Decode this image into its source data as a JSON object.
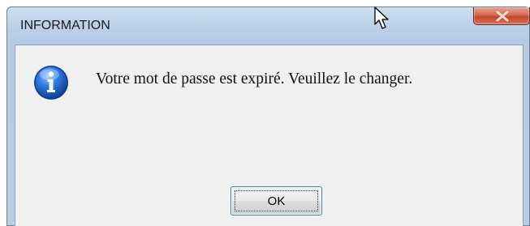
{
  "window": {
    "title": "INFORMATION",
    "close_glyph": "x",
    "close_button_color": "#c3462c",
    "frame_color": "#b9cde5"
  },
  "dialog": {
    "icon": "information-icon",
    "icon_color": "#1f5fbf",
    "message": "Votre mot de passe est expiré. Veuillez le changer.",
    "ok_label": "OK"
  },
  "pointer": {
    "icon": "mouse-cursor-icon"
  }
}
